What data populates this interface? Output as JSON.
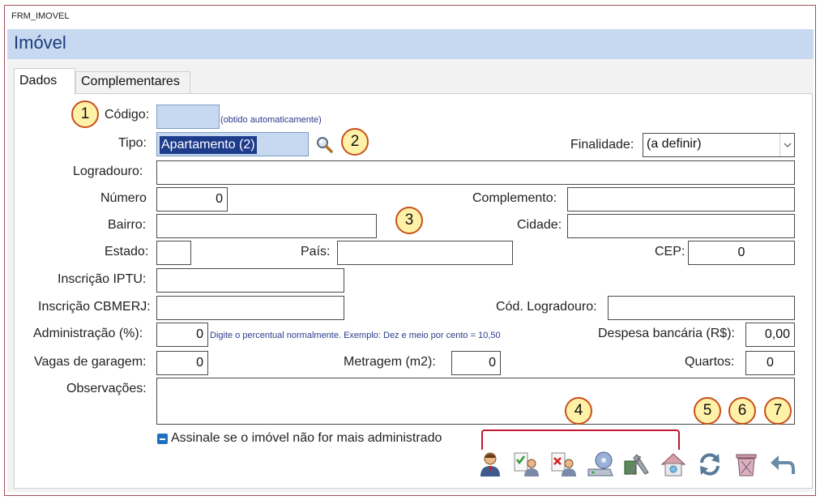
{
  "window": {
    "title": "FRM_IMOVEL"
  },
  "header": {
    "title": "Imóvel"
  },
  "tabs": [
    {
      "label": "Dados",
      "active": true
    },
    {
      "label": "Complementares",
      "active": false
    }
  ],
  "badges": [
    "1",
    "2",
    "3",
    "4",
    "5",
    "6",
    "7"
  ],
  "form": {
    "codigo": {
      "label": "Código:",
      "value": "",
      "hint": "(obtido automaticamente)"
    },
    "tipo": {
      "label": "Tipo:",
      "value": "Apartamento (2)"
    },
    "finalidade": {
      "label": "Finalidade:",
      "value": "(a definir)"
    },
    "logradouro": {
      "label": "Logradouro:",
      "value": ""
    },
    "numero": {
      "label": "Número",
      "value": "0"
    },
    "complemento": {
      "label": "Complemento:",
      "value": ""
    },
    "bairro": {
      "label": "Bairro:",
      "value": ""
    },
    "cidade": {
      "label": "Cidade:",
      "value": ""
    },
    "estado": {
      "label": "Estado:",
      "value": ""
    },
    "pais": {
      "label": "País:",
      "value": ""
    },
    "cep": {
      "label": "CEP:",
      "value": "0"
    },
    "inscricao_iptu": {
      "label": "Inscrição IPTU:",
      "value": ""
    },
    "inscricao_cbmerj": {
      "label": "Inscrição CBMERJ:",
      "value": ""
    },
    "cod_logradouro": {
      "label": "Cód. Logradouro:",
      "value": ""
    },
    "administracao": {
      "label": "Administração (%):",
      "value": "0",
      "hint": "Digite o percentual normalmente. Exemplo: Dez e meio por cento = 10,50"
    },
    "despesa_bancaria": {
      "label": "Despesa bancária (R$):",
      "value": "0,00"
    },
    "vagas_garagem": {
      "label": "Vagas de garagem:",
      "value": "0"
    },
    "metragem": {
      "label": "Metragem (m2):",
      "value": "0"
    },
    "quartos": {
      "label": "Quartos:",
      "value": "0"
    },
    "observacoes": {
      "label": "Observações:",
      "value": ""
    },
    "nao_administrado": {
      "label": "Assinale se o imóvel não for mais administrado",
      "checked": false
    }
  },
  "toolbar": [
    {
      "icon": "person-icon"
    },
    {
      "icon": "person-check-icon"
    },
    {
      "icon": "person-delete-icon"
    },
    {
      "icon": "disk-drive-icon"
    },
    {
      "icon": "tools-icon"
    },
    {
      "icon": "house-icon"
    },
    {
      "icon": "refresh-icon"
    },
    {
      "icon": "trash-icon"
    },
    {
      "icon": "undo-icon"
    }
  ],
  "colors": {
    "header_bg": "#c6d9f1",
    "header_text": "#1f3a78",
    "badge_fill": "#fff2a8",
    "badge_border": "#c8501a",
    "bracket": "#c0172d",
    "selection": "#1e3c8c",
    "input_highlight": "#c6d9f1"
  }
}
